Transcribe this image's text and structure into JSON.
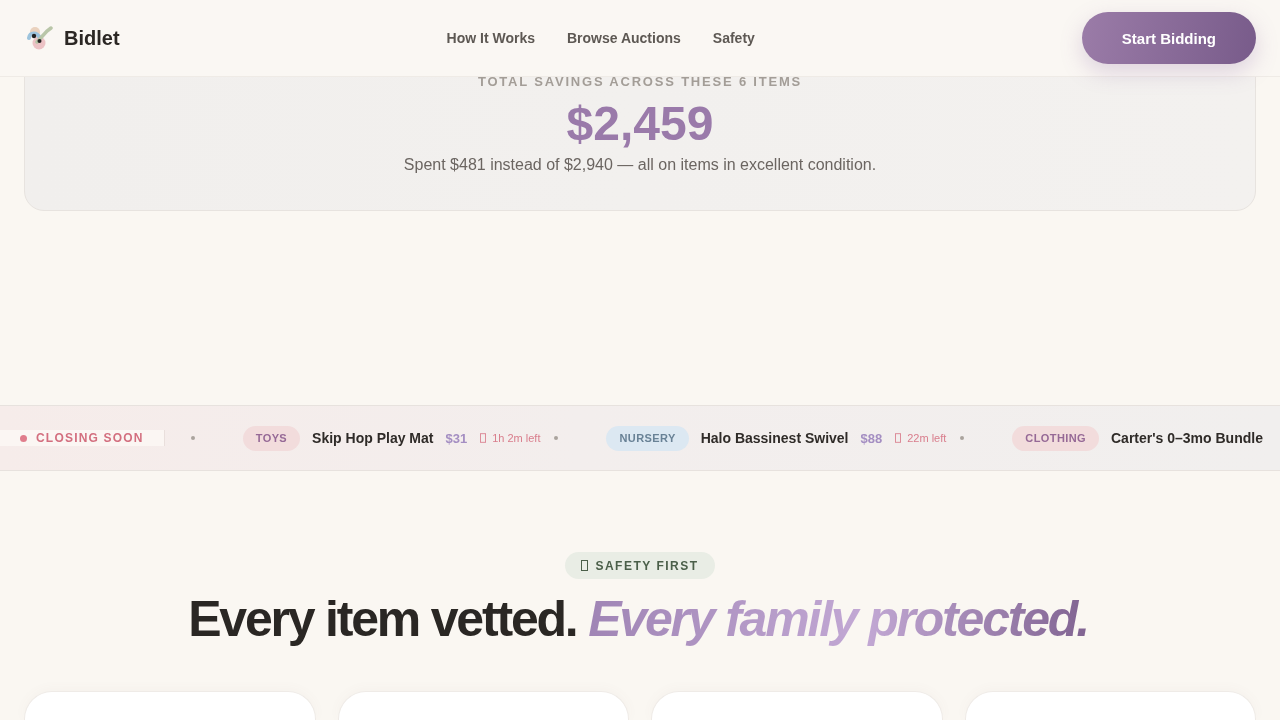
{
  "header": {
    "brand": "Bidlet",
    "nav": [
      "How It Works",
      "Browse Auctions",
      "Safety"
    ],
    "cta": "Start Bidding"
  },
  "savings": {
    "label": "TOTAL SAVINGS ACROSS THESE 6 ITEMS",
    "amount": "$2,459",
    "note": "Spent $481 instead of $2,940 — all on items in excellent condition."
  },
  "ticker": {
    "label": "CLOSING SOON",
    "items": [
      {
        "tag": "TOYS",
        "color": "#f2dcdc",
        "name": "Skip Hop Play Mat",
        "price": "$31",
        "time": "1h 2m left"
      },
      {
        "tag": "NURSERY",
        "color": "#dce8f2",
        "name": "Halo Bassinest Swivel",
        "price": "$88",
        "time": "22m left"
      },
      {
        "tag": "CLOTHING",
        "color": "#f2dcdc",
        "name": "Carter's 0–3mo Bundle"
      }
    ]
  },
  "safety": {
    "badge": "SAFETY FIRST",
    "heading": "Every item vetted. *Every family protected.*"
  }
}
